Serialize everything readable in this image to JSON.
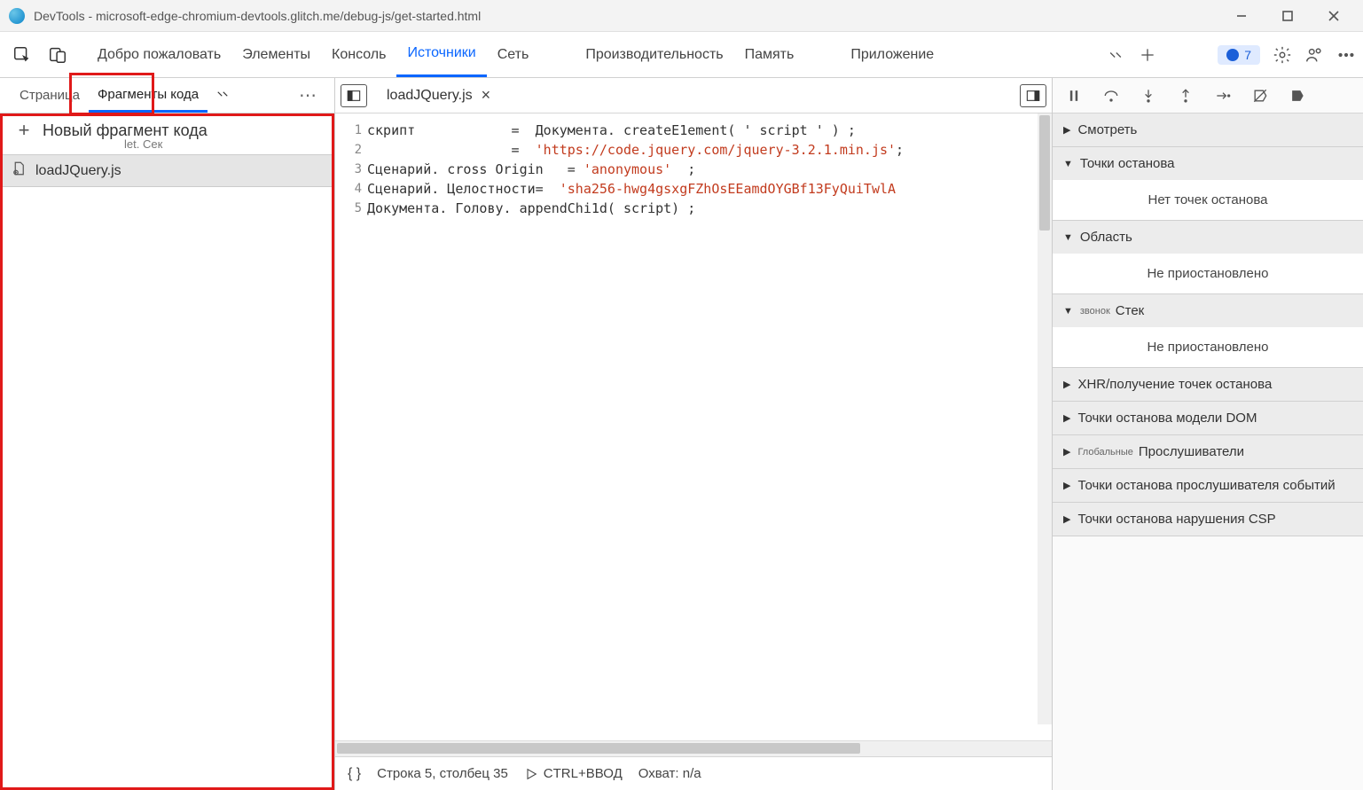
{
  "window": {
    "title": "DevTools - microsoft-edge-chromium-devtools.glitch.me/debug-js/get-started.html"
  },
  "toolbar": {
    "tabs": [
      "Добро пожаловать",
      "Элементы",
      "Консоль",
      "Источники",
      "Сеть",
      "Производительность",
      "Память",
      "Приложение"
    ],
    "active_tab": 3,
    "badge_count": "7"
  },
  "left_panel": {
    "tab_page": "Страница",
    "tab_snippets": "Фрагменты кода",
    "new_snippet": "Новый фрагмент кода",
    "new_snippet_sub": "let. Сек",
    "file": "loadJQuery.js"
  },
  "editor": {
    "filename": "loadJQuery.js",
    "lines": [
      {
        "n": "1",
        "pre": "скрипт            =  Документа. createE1ement( ' script ' ) ;",
        "str": ""
      },
      {
        "n": "2",
        "pre": "                  =  ",
        "str": "'https://code.jquery.com/jquery-3.2.1.min.js'",
        "post": ";"
      },
      {
        "n": "3",
        "pre": "Сценарий. cross Origin   = ",
        "str": "'anonymous'",
        "post": "  ;"
      },
      {
        "n": "4",
        "pre": "Сценарий. Целостности=  ",
        "str": "'sha256-hwg4gsxgFZhOsEEamdOYGBf13FyQuiTwlA",
        "post": ""
      },
      {
        "n": "5",
        "pre": "Документа. Голову. appendChi1d( script) ;",
        "str": ""
      }
    ]
  },
  "statusbar": {
    "brackets": "{ }",
    "position": "Строка 5, столбец 35",
    "run": "CTRL+ВВОД",
    "coverage": "Охват: n/a"
  },
  "debugger": {
    "sections": [
      {
        "label": "Смотреть",
        "expanded": false
      },
      {
        "label": "Точки останова",
        "expanded": true,
        "body": "Нет точек останова"
      },
      {
        "label": "Область",
        "expanded": true,
        "body": "Не приостановлено"
      },
      {
        "prefix": "звонок",
        "label": "Стек",
        "expanded": true,
        "body": "Не приостановлено"
      },
      {
        "label": "XHR/получение точек останова",
        "expanded": false
      },
      {
        "label": "Точки останова модели DOM",
        "expanded": false
      },
      {
        "prefix": "Глобальные",
        "label": "Прослушиватели",
        "expanded": false
      },
      {
        "label": "Точки останова прослушивателя событий",
        "expanded": false
      },
      {
        "label": "Точки останова нарушения CSP",
        "expanded": false
      }
    ]
  }
}
